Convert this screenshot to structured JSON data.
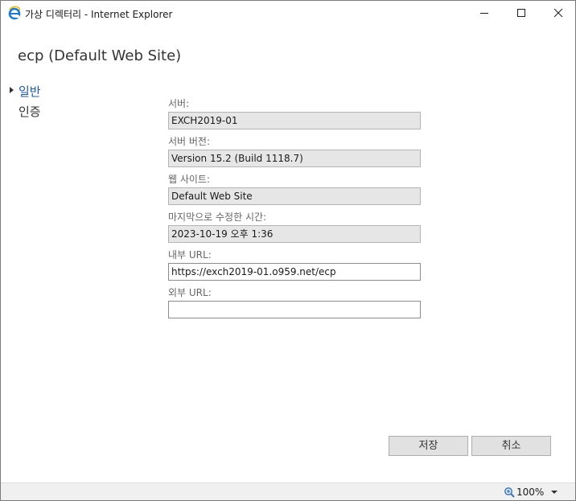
{
  "window": {
    "title": "가상 디렉터리 - Internet Explorer",
    "app_icon": "internet-explorer-icon",
    "controls": {
      "minimize": "minimize-icon",
      "maximize": "maximize-icon",
      "close": "close-icon"
    }
  },
  "page": {
    "title": "ecp (Default Web Site)"
  },
  "nav": {
    "items": [
      {
        "label": "일반",
        "selected": true
      },
      {
        "label": "인증",
        "selected": false
      }
    ]
  },
  "form": {
    "server": {
      "label": "서버:",
      "value": "EXCH2019-01"
    },
    "server_version": {
      "label": "서버 버전:",
      "value": "Version 15.2 (Build 1118.7)"
    },
    "website": {
      "label": "웹 사이트:",
      "value": "Default Web Site"
    },
    "last_modified": {
      "label": "마지막으로 수정한 시간:",
      "value": "2023-10-19 오후 1:36"
    },
    "internal_url": {
      "label": "내부 URL:",
      "value": "https://exch2019-01.o959.net/ecp"
    },
    "external_url": {
      "label": "외부 URL:",
      "value": ""
    }
  },
  "buttons": {
    "save": "저장",
    "cancel": "취소"
  },
  "statusbar": {
    "zoom": "100%",
    "zoom_icon": "zoom-icon"
  },
  "colors": {
    "accent": "#1e5aa8",
    "readonly_bg": "#e6e6e6",
    "button_bg": "#e1e1e1"
  }
}
